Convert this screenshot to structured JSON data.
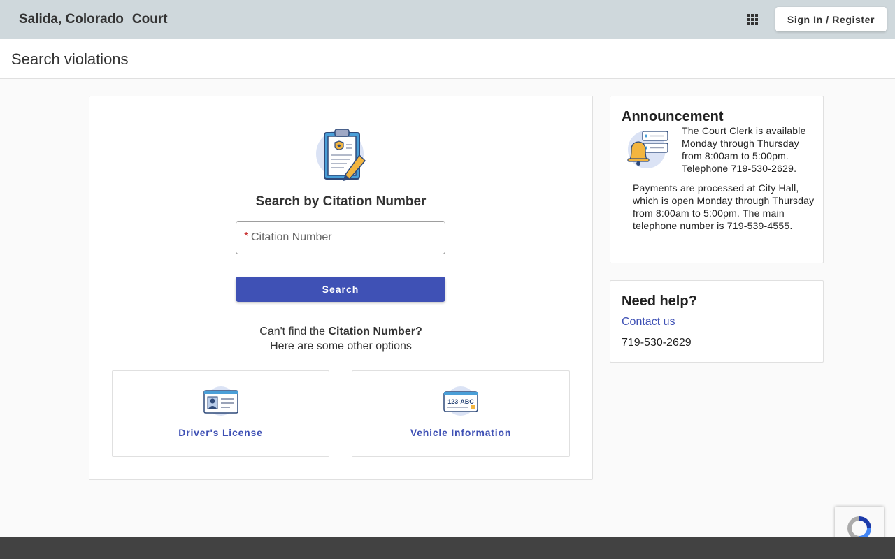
{
  "header": {
    "brand_city": "Salida, Colorado",
    "brand_court": "Court",
    "apps_icon": "grid-apps-icon",
    "signin_label": "Sign In / Register"
  },
  "page": {
    "title": "Search violations"
  },
  "search": {
    "icon": "clipboard-badge-icon",
    "heading": "Search by Citation Number",
    "required_marker": "*",
    "citation_placeholder": "Citation Number",
    "citation_value": "",
    "button_label": "Search",
    "cant_find_prefix": "Can't find the",
    "cant_find_bold": "Citation Number?",
    "other_options": "Here are some other options"
  },
  "options": [
    {
      "label": "Driver's License",
      "icon": "id-card-icon"
    },
    {
      "label": "Vehicle Information",
      "icon": "license-plate-icon",
      "plate_text": "123-ABC"
    }
  ],
  "announcement": {
    "title": "Announcement",
    "icon": "bell-notification-icon",
    "text1": "The Court Clerk is available Monday through Thursday from 8:00am to 5:00pm. Telephone 719-530-2629.",
    "text2": "Payments are processed at City Hall, which is open Monday through Thursday from 8:00am to 5:00pm. The main telephone number is 719-539-4555."
  },
  "help": {
    "title": "Need help?",
    "contact_label": "Contact us",
    "phone": "719-530-2629"
  },
  "colors": {
    "topbar": "#cfd8dc",
    "primary": "#3f51b5",
    "required": "#c62828",
    "footer": "#424242"
  }
}
